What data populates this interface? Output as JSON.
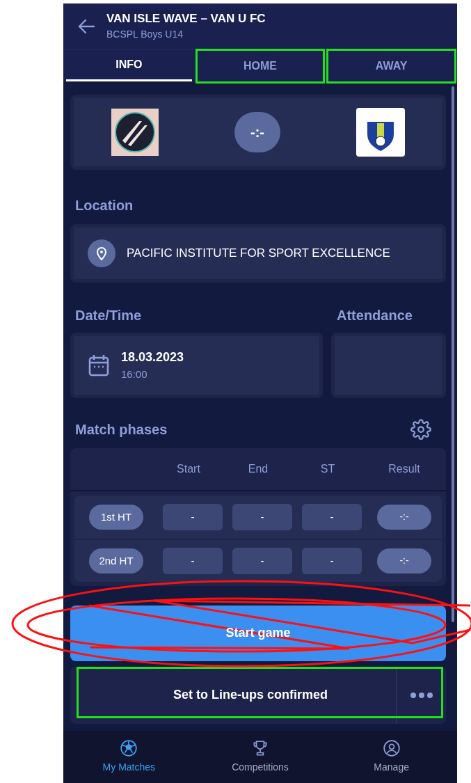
{
  "header": {
    "title": "VAN ISLE WAVE – VAN U FC",
    "subtitle": "BCSPL Boys U14"
  },
  "tabs": [
    {
      "label": "INFO",
      "selected": true,
      "highlighted": false
    },
    {
      "label": "HOME",
      "selected": false,
      "highlighted": true
    },
    {
      "label": "AWAY",
      "selected": false,
      "highlighted": true
    }
  ],
  "score": "-:-",
  "location": {
    "label": "Location",
    "value": "PACIFIC INSTITUTE FOR SPORT EXCELLENCE"
  },
  "datetime": {
    "label": "Date/Time",
    "date": "18.03.2023",
    "time": "16:00"
  },
  "attendance": {
    "label": "Attendance"
  },
  "match_phases": {
    "title": "Match phases",
    "columns": [
      "Start",
      "End",
      "ST",
      "Result"
    ],
    "rows": [
      {
        "phase": "1st HT",
        "start": "-",
        "end": "-",
        "st": "-",
        "result": "-:-"
      },
      {
        "phase": "2nd HT",
        "start": "-",
        "end": "-",
        "st": "-",
        "result": "-:-"
      }
    ]
  },
  "primary_button": {
    "label": "Start game",
    "scribbled": true
  },
  "secondary_button": {
    "label": "Set to Line-ups confirmed",
    "highlighted": true
  },
  "nav": [
    {
      "label": "My Matches",
      "selected": true
    },
    {
      "label": "Competitions",
      "selected": false
    },
    {
      "label": "Manage",
      "selected": false
    }
  ]
}
